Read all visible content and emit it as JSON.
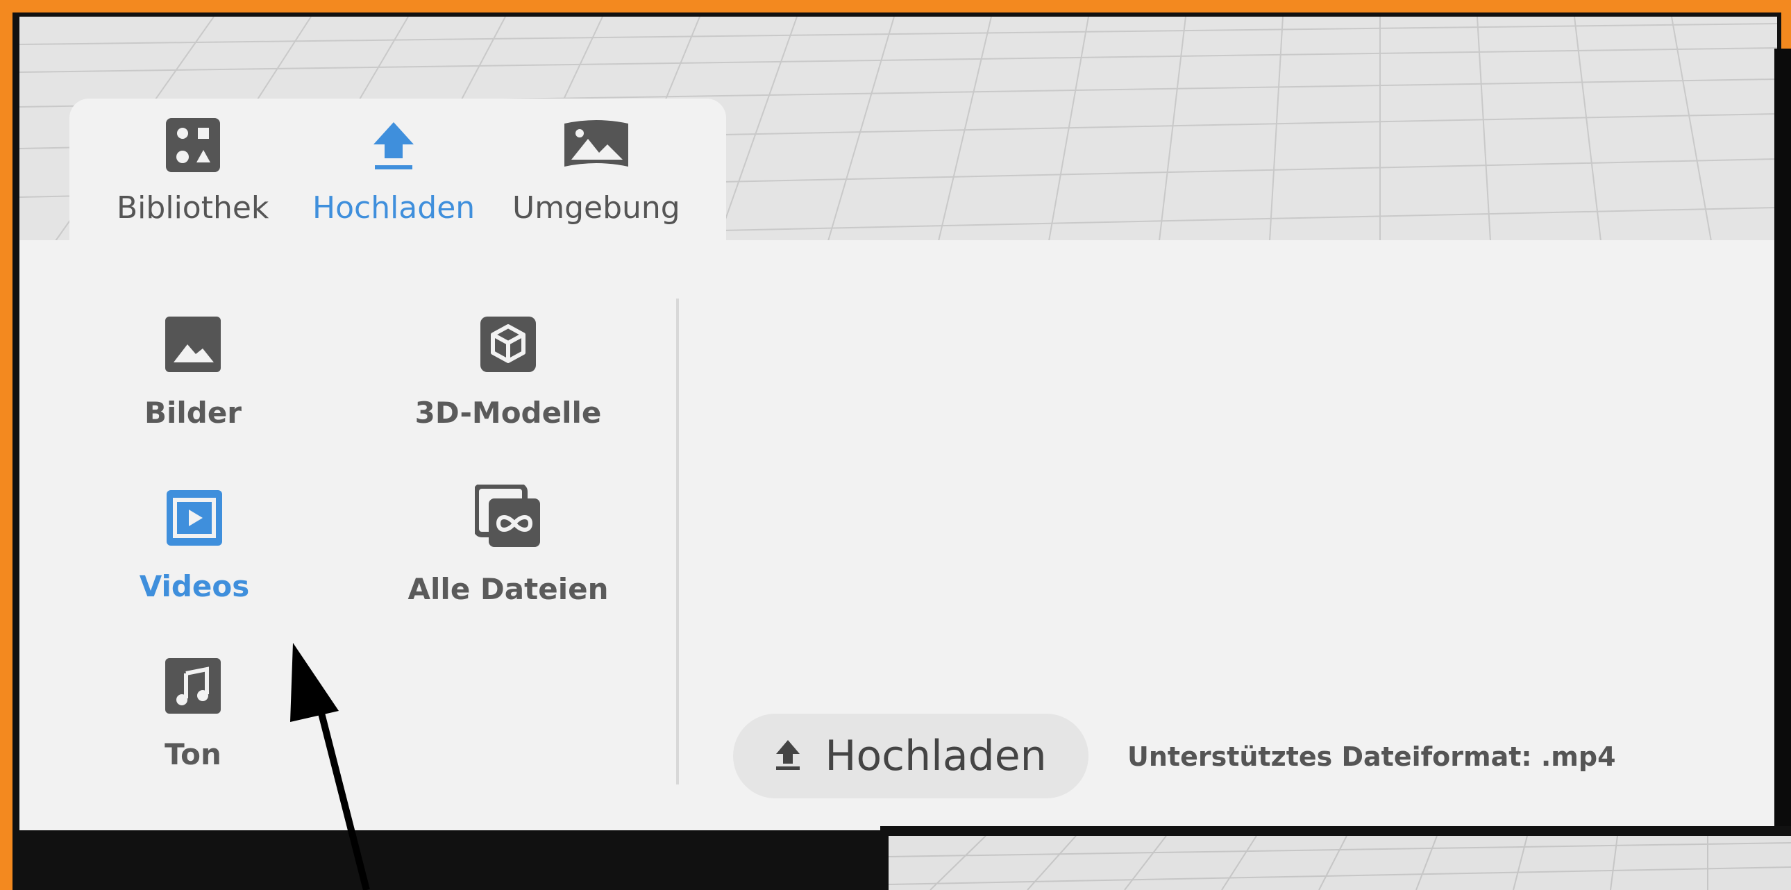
{
  "tabs": [
    {
      "id": "library",
      "label": "Bibliothek",
      "icon": "shapes-icon",
      "active": false
    },
    {
      "id": "upload",
      "label": "Hochladen",
      "icon": "upload-icon",
      "active": true
    },
    {
      "id": "environment",
      "label": "Umgebung",
      "icon": "panorama-icon",
      "active": false
    }
  ],
  "categories": [
    {
      "label": "Bilder",
      "icon": "image-icon",
      "active": false
    },
    {
      "label": "3D-Modelle",
      "icon": "cube-icon",
      "active": false
    },
    {
      "label": "Videos",
      "icon": "video-icon",
      "active": true
    },
    {
      "label": "Alle Dateien",
      "icon": "all-files-icon",
      "active": false
    },
    {
      "label": "Ton",
      "icon": "music-icon",
      "active": false
    }
  ],
  "upload": {
    "button_label": "Hochladen",
    "supported_format": "Unterstütztes Dateiformat: .mp4"
  },
  "colors": {
    "accent": "#3f8fdc",
    "frame": "#f3891f",
    "icon_gray": "#555555",
    "panel": "#f2f2f2"
  }
}
